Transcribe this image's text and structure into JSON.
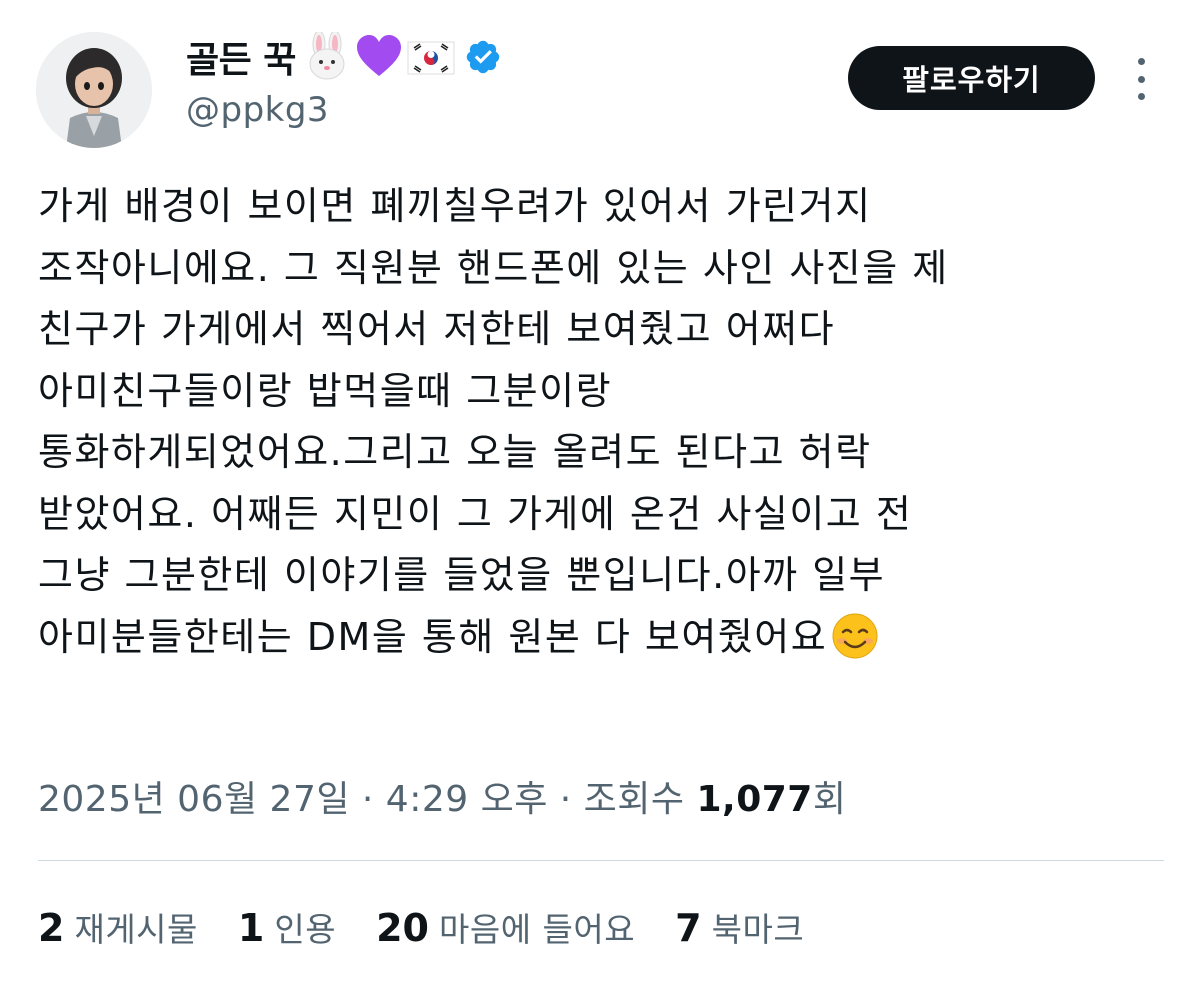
{
  "author": {
    "display_name": "골든 꾹",
    "handle": "@ppkg3",
    "badges": [
      "rabbit-emoji",
      "purple-heart-emoji",
      "korea-flag-emoji"
    ],
    "verified": true
  },
  "follow_button": {
    "label": "팔로우하기"
  },
  "tweet": {
    "lines": [
      "가게 배경이 보이면 폐끼칠우려가 있어서 가린거지",
      "조작아니에요. 그 직원분 핸드폰에 있는 사인 사진을 제",
      "친구가 가게에서 찍어서 저한테 보여줬고 어쩌다",
      "아미친구들이랑 밥먹을때 그분이랑",
      "통화하게되었어요.그리고 오늘 올려도 된다고 허락",
      "받았어요. 어째든 지민이 그 가게에 온건 사실이고 전",
      "그냥 그분한테  이야기를 들었을 뿐입니다.아까 일부",
      "아미분들한테는  DM을 통해 원본 다 보여줬어요"
    ],
    "trailing_emoji": "smiling-face-emoji"
  },
  "meta": {
    "datetime": "2025년 06월 27일 · 4:29 오후 · 조회수 ",
    "views_count": "1,077",
    "views_suffix": "회"
  },
  "stats": [
    {
      "count": "2",
      "label": "재게시물"
    },
    {
      "count": "1",
      "label": "인용"
    },
    {
      "count": "20",
      "label": "마음에 들어요"
    },
    {
      "count": "7",
      "label": "북마크"
    }
  ],
  "colors": {
    "text_primary": "#0f1419",
    "text_secondary": "#536471",
    "verified_blue": "#1d9bf0",
    "divider": "#cfd9de"
  }
}
